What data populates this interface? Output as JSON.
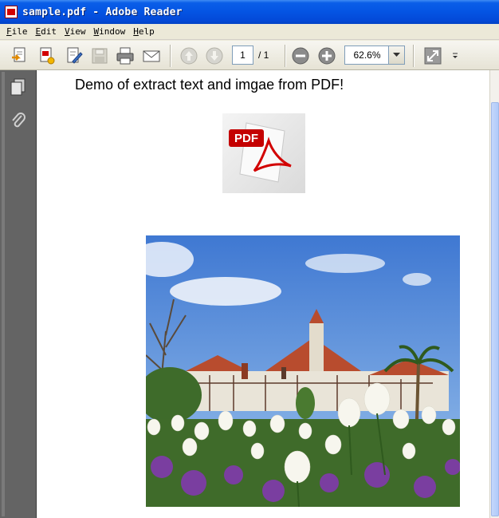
{
  "window": {
    "title": "sample.pdf - Adobe Reader"
  },
  "menu": {
    "items": [
      {
        "first": "F",
        "rest": "ile"
      },
      {
        "first": "E",
        "rest": "dit"
      },
      {
        "first": "V",
        "rest": "iew"
      },
      {
        "first": "W",
        "rest": "indow"
      },
      {
        "first": "H",
        "rest": "elp"
      }
    ]
  },
  "toolbar": {
    "page_current": "1",
    "page_total": "/ 1",
    "zoom_value": "62.6%"
  },
  "document": {
    "heading": "Demo of extract text and imgae from PDF!",
    "pdf_logo_text": "PDF"
  },
  "colors": {
    "title_bar": "#0454e3",
    "nav_panel": "#646464",
    "pdf_red": "#d20000"
  }
}
